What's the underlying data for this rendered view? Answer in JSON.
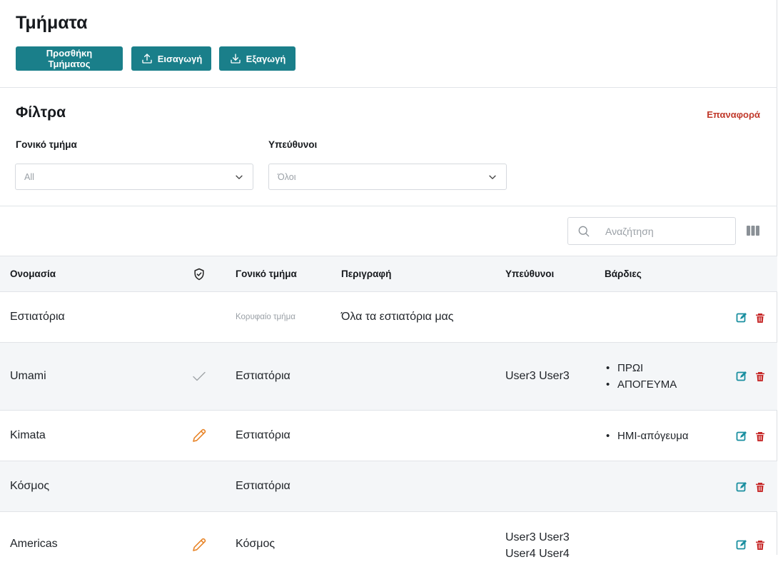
{
  "header": {
    "title": "Τμήματα",
    "add_label": "Προσθήκη Τμήματος",
    "import_label": "Εισαγωγή",
    "export_label": "Εξαγωγή",
    "accent": "#1a7f8a"
  },
  "filters": {
    "title": "Φίλτρα",
    "reset_label": "Επαναφορά",
    "parent": {
      "label": "Γονικό τμήμα",
      "value": "All"
    },
    "owners": {
      "label": "Υπεύθυνοι",
      "value": "Όλοι"
    }
  },
  "search": {
    "placeholder": "Αναζήτηση"
  },
  "table": {
    "columns": {
      "name": "Ονομασία",
      "parent": "Γονικό τμήμα",
      "description": "Περιγραφή",
      "owners": "Υπεύθυνοι",
      "shifts": "Βάρδιες"
    },
    "rows": [
      {
        "name": "Εστιατόρια",
        "parent": "Κορυφαίο τμήμα",
        "description": "Όλα τα εστιατόρια μας",
        "owners": "",
        "shifts": []
      },
      {
        "name": "Umami",
        "status_icon": "check-icon",
        "parent": "Εστιατόρια",
        "description": "",
        "owners": "User3 User3",
        "shifts": [
          "ΠΡΩΙ",
          "ΑΠΟΓΕΥΜΑ"
        ]
      },
      {
        "name": "Kimata",
        "status_icon": "pencil-icon",
        "parent": "Εστιατόρια",
        "description": "",
        "owners": "",
        "shifts": [
          "ΗΜΙ-απόγευμα"
        ]
      },
      {
        "name": "Κόσμος",
        "parent": "Εστιατόρια",
        "description": "",
        "owners": "",
        "shifts": []
      },
      {
        "name": "Americas",
        "status_icon": "pencil-icon",
        "parent": "Κόσμος",
        "description": "",
        "owners": [
          "User3 User3",
          "User4 User4"
        ],
        "shifts": []
      }
    ]
  },
  "colors": {
    "edit": "#1a8fa0",
    "delete": "#c62828",
    "pencil": "#e8862b"
  }
}
